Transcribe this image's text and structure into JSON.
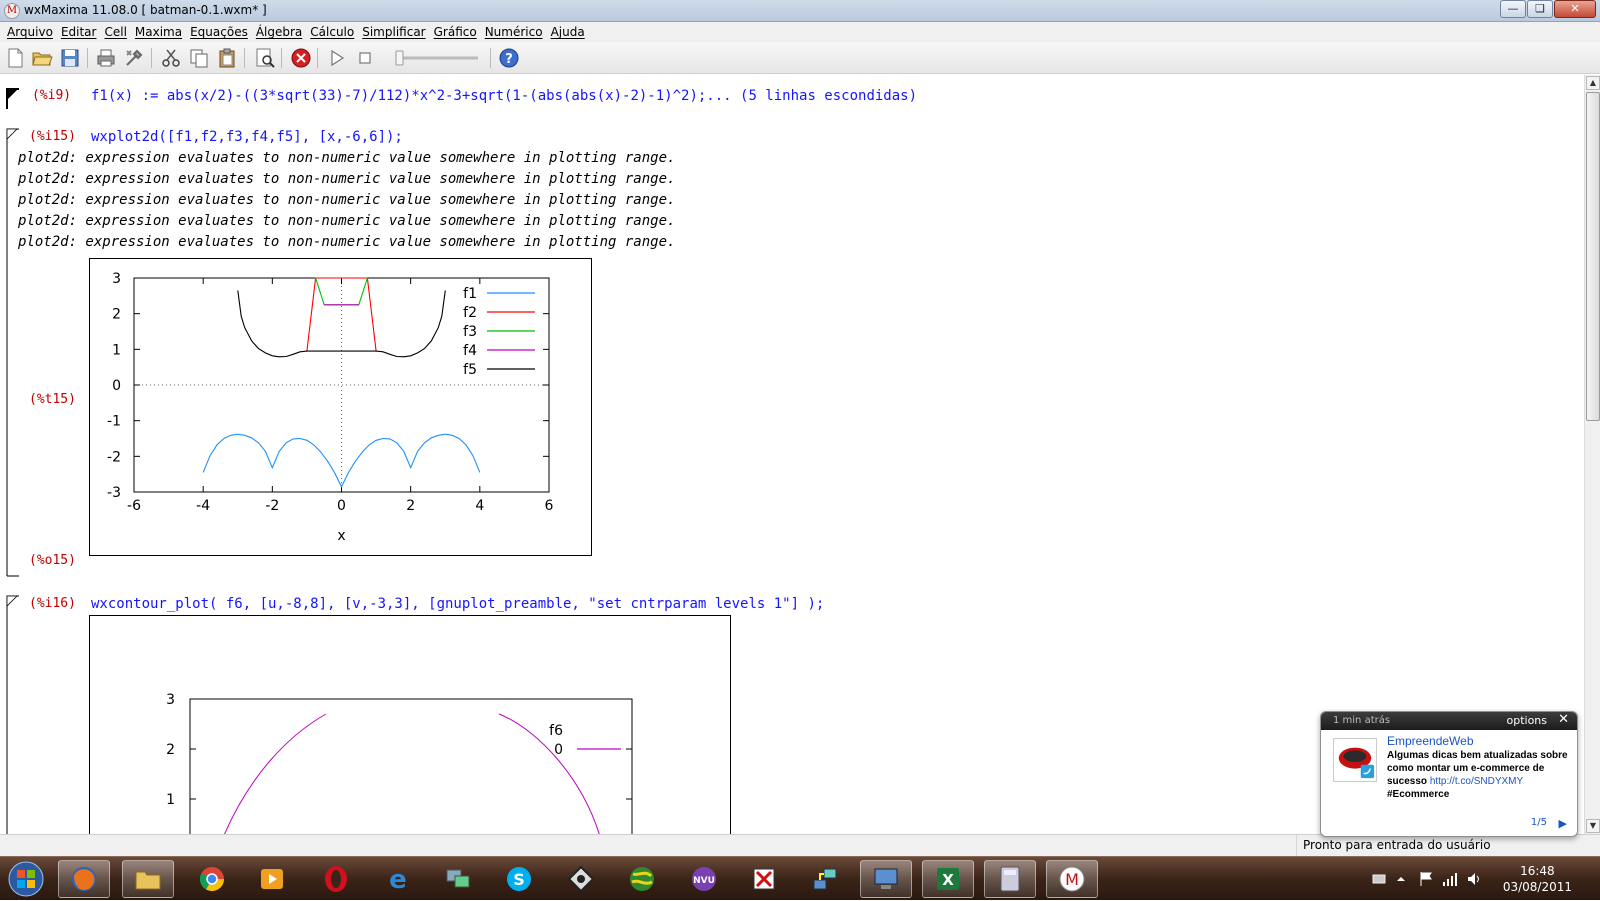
{
  "window": {
    "title": "wxMaxima 11.08.0  [ batman-0.1.wxm* ]",
    "icon": "maxima-app-icon"
  },
  "menu": [
    "Arquivo",
    "Editar",
    "Cell",
    "Maxima",
    "Equações",
    "Álgebra",
    "Cálculo",
    "Simplificar",
    "Gráfico",
    "Numérico",
    "Ajuda"
  ],
  "toolbar": {
    "icons": [
      "new-document-icon",
      "open-folder-icon",
      "save-icon",
      "print-icon",
      "preferences-icon",
      "cut-icon",
      "copy-icon",
      "paste-icon",
      "find-icon",
      "interrupt-icon",
      "play-icon",
      "stop-icon",
      "animation-slider",
      "help-icon"
    ]
  },
  "cells": {
    "i9": {
      "label": "(%i9)",
      "input": "f1(x) := abs(x/2)-((3*sqrt(33)-7)/112)*x^2-3+sqrt(1-(abs(abs(x)-2)-1)^2);... (5 linhas escondidas)"
    },
    "i15": {
      "label": "(%i15)",
      "input": "wxplot2d([f1,f2,f3,f4,f5], [x,-6,6]);",
      "warnings": [
        "plot2d: expression evaluates to non-numeric value somewhere in plotting range.",
        "plot2d: expression evaluates to non-numeric value somewhere in plotting range.",
        "plot2d: expression evaluates to non-numeric value somewhere in plotting range.",
        "plot2d: expression evaluates to non-numeric value somewhere in plotting range.",
        "plot2d: expression evaluates to non-numeric value somewhere in plotting range."
      ],
      "t_label": "(%t15)",
      "o_label": "(%o15)"
    },
    "i16": {
      "label": "(%i16)",
      "input": "wxcontour_plot( f6, [u,-8,8], [v,-3,3], [gnuplot_preamble, \"set cntrparam levels 1\"] );"
    }
  },
  "chart_data": [
    {
      "type": "line",
      "xlabel": "x",
      "ylabel": "",
      "xlim": [
        -6,
        6
      ],
      "ylim": [
        -3,
        3
      ],
      "xticks": [
        "-6",
        "-4",
        "-2",
        "0",
        "2",
        "4",
        "6"
      ],
      "yticks": [
        "3",
        "2",
        "1",
        "0",
        "-1",
        "-2",
        "-3"
      ],
      "legend": "top-right",
      "zero_axes": true,
      "series": [
        {
          "name": "f1",
          "color": "#1e90ff",
          "points": [
            [
              -4.0,
              -2.45
            ],
            [
              -3.8,
              -1.98
            ],
            [
              -3.6,
              -1.68
            ],
            [
              -3.4,
              -1.5
            ],
            [
              -3.2,
              -1.41
            ],
            [
              -3.0,
              -1.38
            ],
            [
              -2.8,
              -1.41
            ],
            [
              -2.6,
              -1.48
            ],
            [
              -2.4,
              -1.62
            ],
            [
              -2.2,
              -1.86
            ],
            [
              -2.0,
              -2.32
            ],
            [
              -1.8,
              -1.86
            ],
            [
              -1.6,
              -1.62
            ],
            [
              -1.4,
              -1.51
            ],
            [
              -1.2,
              -1.5
            ],
            [
              -1.0,
              -1.55
            ],
            [
              -0.8,
              -1.68
            ],
            [
              -0.6,
              -1.88
            ],
            [
              -0.4,
              -2.14
            ],
            [
              -0.2,
              -2.46
            ],
            [
              0.0,
              -2.85
            ],
            [
              0.2,
              -2.46
            ],
            [
              0.4,
              -2.14
            ],
            [
              0.6,
              -1.88
            ],
            [
              0.8,
              -1.68
            ],
            [
              1.0,
              -1.55
            ],
            [
              1.2,
              -1.5
            ],
            [
              1.4,
              -1.51
            ],
            [
              1.6,
              -1.62
            ],
            [
              1.8,
              -1.86
            ],
            [
              2.0,
              -2.32
            ],
            [
              2.2,
              -1.86
            ],
            [
              2.4,
              -1.62
            ],
            [
              2.6,
              -1.48
            ],
            [
              2.8,
              -1.41
            ],
            [
              3.0,
              -1.38
            ],
            [
              3.2,
              -1.41
            ],
            [
              3.4,
              -1.5
            ],
            [
              3.6,
              -1.68
            ],
            [
              3.8,
              -1.98
            ],
            [
              4.0,
              -2.45
            ]
          ]
        },
        {
          "name": "f2",
          "color": "#ff0000",
          "points": [
            [
              -1.0,
              0.95
            ],
            [
              -0.75,
              3.0
            ],
            [
              0.75,
              3.0
            ],
            [
              1.0,
              0.95
            ]
          ]
        },
        {
          "name": "f3",
          "color": "#00c000",
          "points": [
            [
              -0.75,
              3.0
            ],
            [
              -0.5,
              2.25
            ],
            [
              0.5,
              2.25
            ],
            [
              0.75,
              3.0
            ]
          ]
        },
        {
          "name": "f4",
          "color": "#c000c0",
          "points": [
            [
              -0.5,
              2.25
            ],
            [
              0.5,
              2.25
            ]
          ]
        },
        {
          "name": "f5",
          "color": "#000000",
          "points": [
            [
              -3.0,
              2.65
            ],
            [
              -2.9,
              1.93
            ],
            [
              -2.8,
              1.61
            ],
            [
              -2.6,
              1.24
            ],
            [
              -2.4,
              1.02
            ],
            [
              -2.2,
              0.9
            ],
            [
              -2.0,
              0.82
            ],
            [
              -1.8,
              0.79
            ],
            [
              -1.6,
              0.8
            ],
            [
              -1.4,
              0.86
            ],
            [
              -1.2,
              0.93
            ],
            [
              -1.0,
              0.95
            ],
            [
              1.0,
              0.95
            ],
            [
              1.2,
              0.93
            ],
            [
              1.4,
              0.86
            ],
            [
              1.6,
              0.8
            ],
            [
              1.8,
              0.79
            ],
            [
              2.0,
              0.82
            ],
            [
              2.2,
              0.9
            ],
            [
              2.4,
              1.02
            ],
            [
              2.6,
              1.24
            ],
            [
              2.8,
              1.61
            ],
            [
              2.9,
              1.93
            ],
            [
              3.0,
              2.65
            ]
          ]
        }
      ]
    },
    {
      "type": "line",
      "yticks": [
        "3",
        "2",
        "1"
      ],
      "ylim_visible": [
        1,
        3
      ],
      "legend": "top-right",
      "legend_title": "f6",
      "series": [
        {
          "name": "0",
          "color": "#c000c0"
        }
      ]
    }
  ],
  "statusbar": {
    "status": "Pronto para entrada do usuário"
  },
  "taskbar": {
    "start": "windows-start-orb-icon",
    "apps": [
      "firefox-icon",
      "file-explorer-icon",
      "chrome-icon",
      "media-player-icon",
      "opera-icon",
      "internet-explorer-icon",
      "remote-desktop-icon",
      "skype-icon",
      "inkscape-icon",
      "globe-app-icon",
      "nvu-icon",
      "task-tool-icon",
      "network-tool-icon",
      "computer-network-icon",
      "excel-icon",
      "calculator-icon",
      "maxima-icon"
    ],
    "time": "16:48",
    "date": "03/08/2011"
  },
  "notification": {
    "time": "1 min atrás",
    "options": "options",
    "close": "✕",
    "name": "EmpreendeWeb",
    "message": "Algumas dicas bem atualizadas sobre como montar um e-commerce de sucesso",
    "link": "http://t.co/SNDYXMY",
    "hashtag": "#Ecommerce",
    "pager": "1/5"
  },
  "colors": {
    "input_text": "#1515ff",
    "label_text": "#c00000",
    "titlebar": "#c4d3e6",
    "taskbar": "#3b2418"
  }
}
